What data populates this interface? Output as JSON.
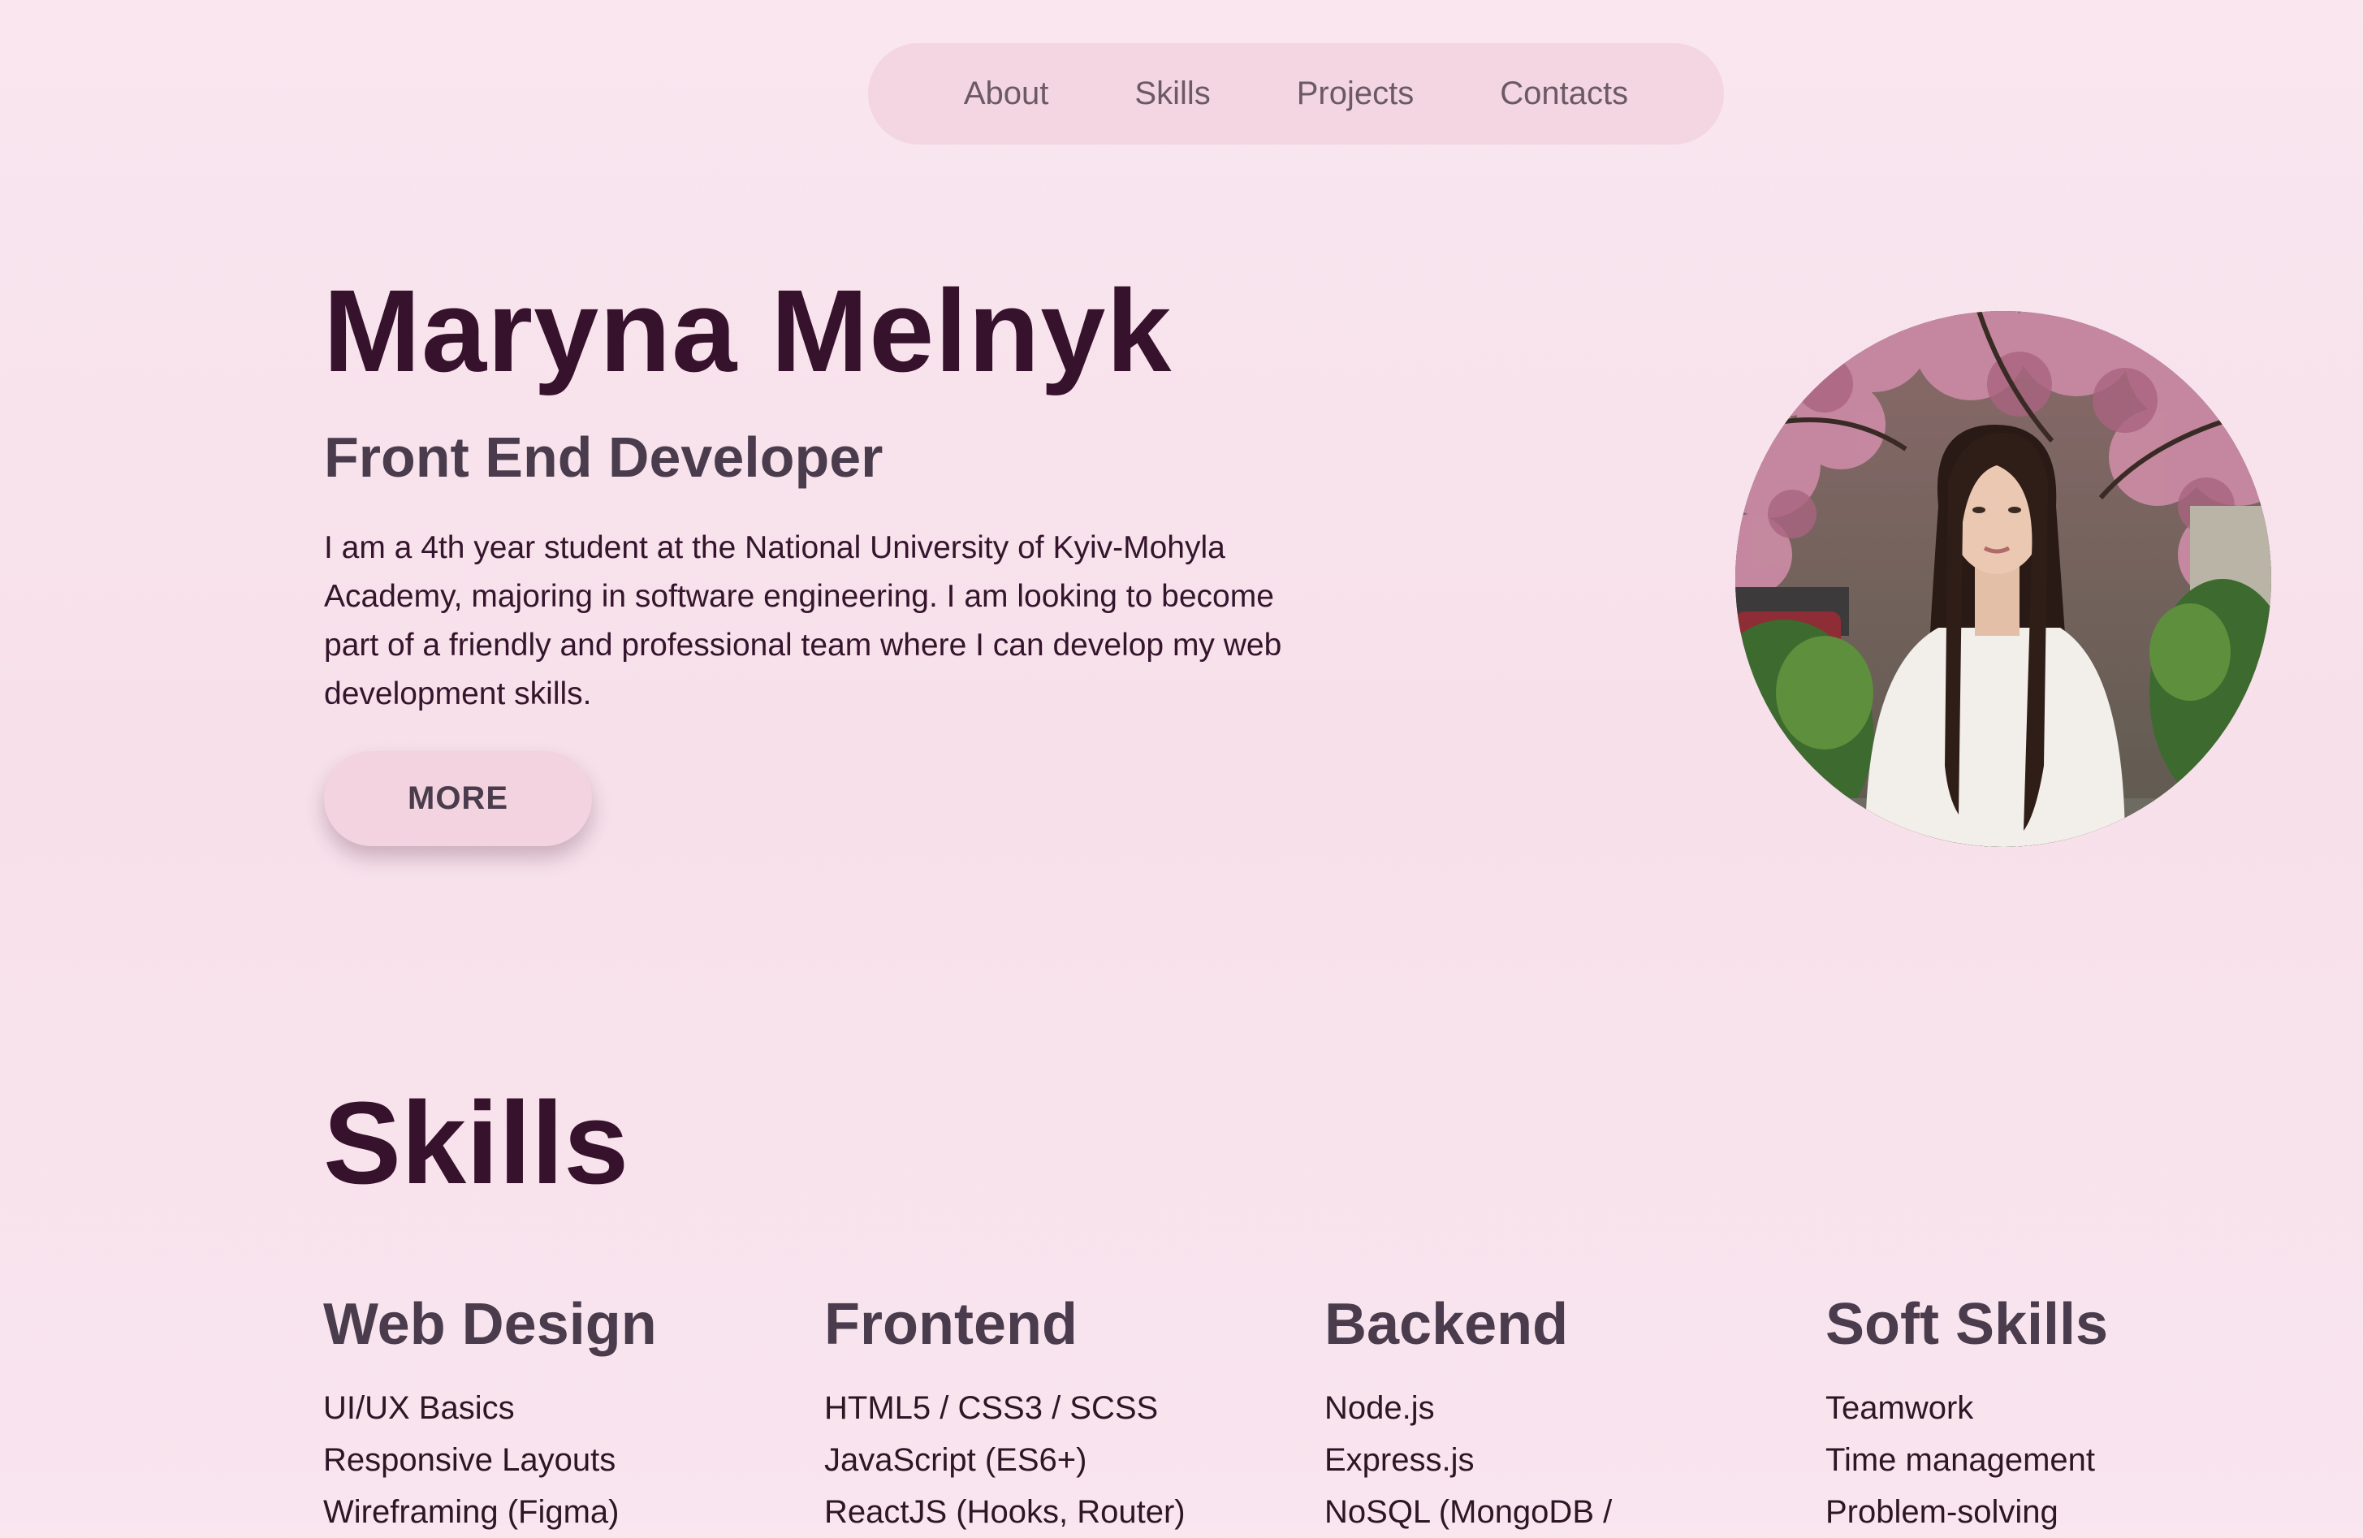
{
  "nav": {
    "items": [
      {
        "label": "About"
      },
      {
        "label": "Skills"
      },
      {
        "label": "Projects"
      },
      {
        "label": "Contacts"
      }
    ]
  },
  "hero": {
    "name": "Maryna Melnyk",
    "role": "Front End Developer",
    "description": "I am a 4th year student at the National University of Kyiv-Mohyla Academy, majoring in software engineering. I am looking to become part of a friendly and professional team where I can develop my web development skills.",
    "more_button": "MORE",
    "photo_alt": "Portrait photo"
  },
  "skills": {
    "title": "Skills",
    "columns": [
      {
        "heading": "Web Design",
        "items": [
          "UI/UX Basics",
          "Responsive Layouts",
          "Wireframing (Figma)"
        ]
      },
      {
        "heading": "Frontend",
        "items": [
          "HTML5 / CSS3 / SCSS",
          "JavaScript (ES6+)",
          "ReactJS (Hooks, Router)"
        ]
      },
      {
        "heading": "Backend",
        "items": [
          "Node.js",
          "Express.js",
          "NoSQL (MongoDB /"
        ]
      },
      {
        "heading": "Soft Skills",
        "items": [
          "Teamwork",
          "Time management",
          "Problem-solving"
        ]
      }
    ]
  },
  "colors": {
    "background": "#f9e6ef",
    "nav_bg": "#f3d6e1",
    "heading": "#37122d",
    "subheading": "#4a3c4d",
    "body_text": "#34152c"
  }
}
